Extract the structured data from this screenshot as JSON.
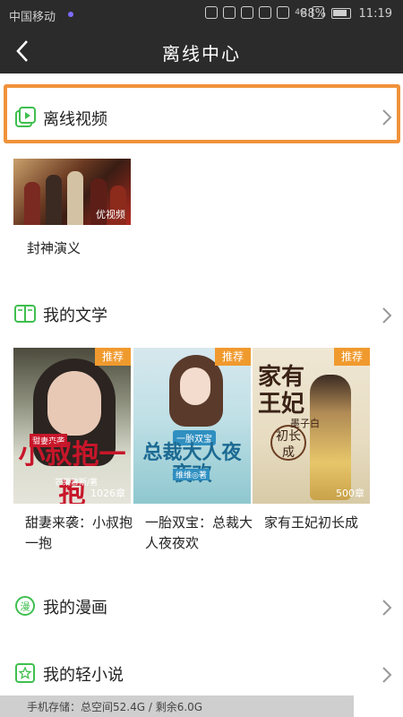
{
  "status_bar": {
    "carrier": "中国移动",
    "signal_label": "4G",
    "battery": "88%",
    "time": "11:19"
  },
  "nav": {
    "title": "离线中心"
  },
  "sections": {
    "video": {
      "label": "离线视频",
      "icon": "video-play-icon"
    },
    "literature": {
      "label": "我的文学",
      "icon": "open-book-icon"
    },
    "comics": {
      "label": "我的漫画",
      "icon": "comic-icon"
    },
    "light_novel": {
      "label": "我的轻小说",
      "icon": "star-book-icon"
    }
  },
  "videos": [
    {
      "title": "封神演义",
      "watermark": "优视频"
    }
  ],
  "books": [
    {
      "title": "甜妻来袭：小叔抱一抱",
      "badge": "推荐",
      "cover_title": "小叔抱一抱",
      "cover_sub": "甜妻来袭",
      "cover_author": "芒果慕斯/著",
      "chapters": "1026章"
    },
    {
      "title": "一胎双宝：总裁大人夜夜欢",
      "badge": "推荐",
      "cover_title": "总裁大人夜夜欢",
      "cover_sub": "一胎双宝",
      "cover_author": "维维◎著",
      "chapters": ""
    },
    {
      "title": "家有王妃初长成",
      "badge": "推荐",
      "cover_title": "家有王妃",
      "cover_seal": "初长成",
      "cover_author": "墨子白",
      "chapters": "500章"
    }
  ],
  "storage": {
    "text": "手机存储：总空间52.4G / 剩余6.0G"
  },
  "colors": {
    "highlight": "#f0923a",
    "accent_green": "#3fbf4f",
    "badge": "#f09a2e",
    "bar_dark": "#2b2b2b"
  }
}
